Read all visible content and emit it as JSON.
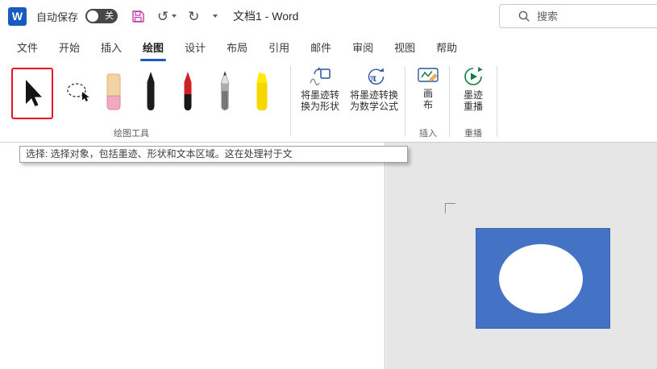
{
  "titlebar": {
    "app_logo": "W",
    "autosave_label": "自动保存",
    "autosave_state": "关",
    "undo_glyph": "↺",
    "redo_glyph": "↻",
    "doc_title": "文档1 - Word",
    "search_placeholder": "搜索"
  },
  "tabs": [
    {
      "label": "文件"
    },
    {
      "label": "开始"
    },
    {
      "label": "插入"
    },
    {
      "label": "绘图"
    },
    {
      "label": "设计"
    },
    {
      "label": "布局"
    },
    {
      "label": "引用"
    },
    {
      "label": "邮件"
    },
    {
      "label": "审阅"
    },
    {
      "label": "视图"
    },
    {
      "label": "帮助"
    }
  ],
  "ribbon": {
    "convert_shape": {
      "line1": "将墨迹转",
      "line2": "换为形状"
    },
    "convert_math": {
      "line1": "将墨迹转换",
      "line2": "为数学公式"
    },
    "canvas": {
      "line1": "画",
      "line2": "布"
    },
    "ink_replay": {
      "line1": "墨迹",
      "line2": "重播"
    },
    "groups": {
      "draw_tools": "绘图工具",
      "insert": "插入",
      "replay": "重播"
    }
  },
  "tooltip": "选择: 选择对象，包括墨迹、形状和文本区域。这在处理衬于文",
  "icons": {
    "select": "cursor-arrow",
    "lasso": "dashed-ellipse-cursor",
    "save": "floppy-disk",
    "search": "magnifier",
    "ink_replay": "green-play-circle"
  },
  "colors": {
    "accent": "#185ABD",
    "shape_fill": "#4472C4",
    "selection_box": "#E81123",
    "canvas_bg": "#E7E6E6"
  }
}
